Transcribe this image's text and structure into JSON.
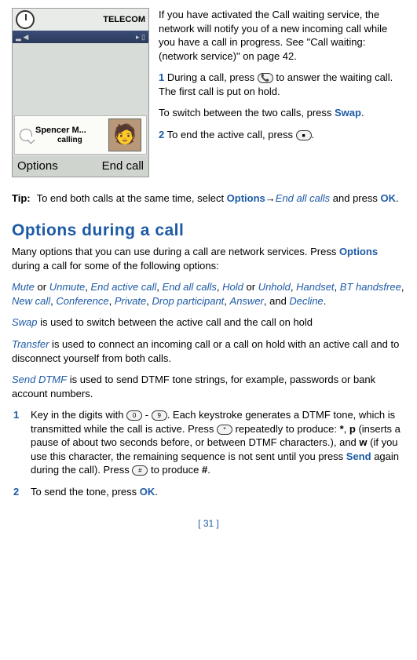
{
  "phone": {
    "carrier": "TELECOM",
    "caller_name": "Spencer M...",
    "caller_status": "calling",
    "softkey_left": "Options",
    "softkey_right": "End call"
  },
  "intro": {
    "para1": "If you have activated the Call waiting service, the network will notify you of a new incoming call while you have a call in progress. See \"Call waiting: (network service)\" on page 42.",
    "step1_num": "1",
    "step1_text_a": " During a call, press ",
    "step1_text_b": " to answer the waiting call. The first call is put on hold.",
    "switch_text_a": "To switch between the two calls, press ",
    "switch_link": "Swap",
    "switch_text_b": ".",
    "step2_num": "2",
    "step2_text_a": " To end the active call, press ",
    "step2_text_b": "."
  },
  "tip": {
    "label": "Tip:",
    "body_a": "To end both calls at the same time, select ",
    "options": "Options",
    "arrow": "→",
    "endall": "End all calls",
    "body_b": " and press ",
    "ok": "OK",
    "body_c": "."
  },
  "section": {
    "title": "Options during a call",
    "intro_a": "Many options that you can use during a call are network services. Press ",
    "intro_b": " during a call for some of the following options:",
    "opts": {
      "mute": "Mute",
      "or1": " or ",
      "unmute": "Unmute",
      "c1": ", ",
      "endactive": "End active call",
      "c2": ", ",
      "endall": "End all calls",
      "c3": ", ",
      "hold": "Hold",
      "or2": " or ",
      "unhold": "Unhold",
      "c4": ", ",
      "handset": "Handset",
      "c5": ", ",
      "bt": "BT handsfree",
      "c6": ", ",
      "newcall": "New call",
      "c7": ",  ",
      "conf": "Conference",
      "c8": ", ",
      "private": "Private",
      "c9": ", ",
      "drop": "Drop participant",
      "c10": ", ",
      "answer": "Answer",
      "c11": ", and ",
      "decline": "Decline",
      "c12": "."
    },
    "swap_a": "Swap",
    "swap_b": " is used to switch between the active call and the call on hold",
    "transfer_a": "Transfer",
    "transfer_b": " is used to connect an incoming call or a call on hold with an active call and to disconnect yourself from both calls.",
    "dtmf_a": "Send DTMF",
    "dtmf_b": " is used to send DTMF tone strings, for example, passwords or bank account numbers."
  },
  "steps": {
    "s1_num": "1",
    "s1_a": "Key in the digits with ",
    "s1_b": " - ",
    "s1_c": ". Each keystroke generates a DTMF tone, which is transmitted while the call is active. Press ",
    "s1_d": " repeatedly to produce: ",
    "s1_star": "*",
    "s1_e": ", ",
    "s1_p": "p",
    "s1_f": " (inserts a pause of about two seconds before, or between DTMF characters.), and ",
    "s1_w": "w",
    "s1_g": " (if you use this character, the remaining sequence is not sent until you press ",
    "s1_send": "Send",
    "s1_h": " again during the call). Press ",
    "s1_i": " to produce ",
    "s1_hash": "#",
    "s1_j": ".",
    "s2_num": "2",
    "s2_a": "To send the tone, press ",
    "s2_ok": "OK",
    "s2_b": "."
  },
  "page_number": "[ 31 ]"
}
